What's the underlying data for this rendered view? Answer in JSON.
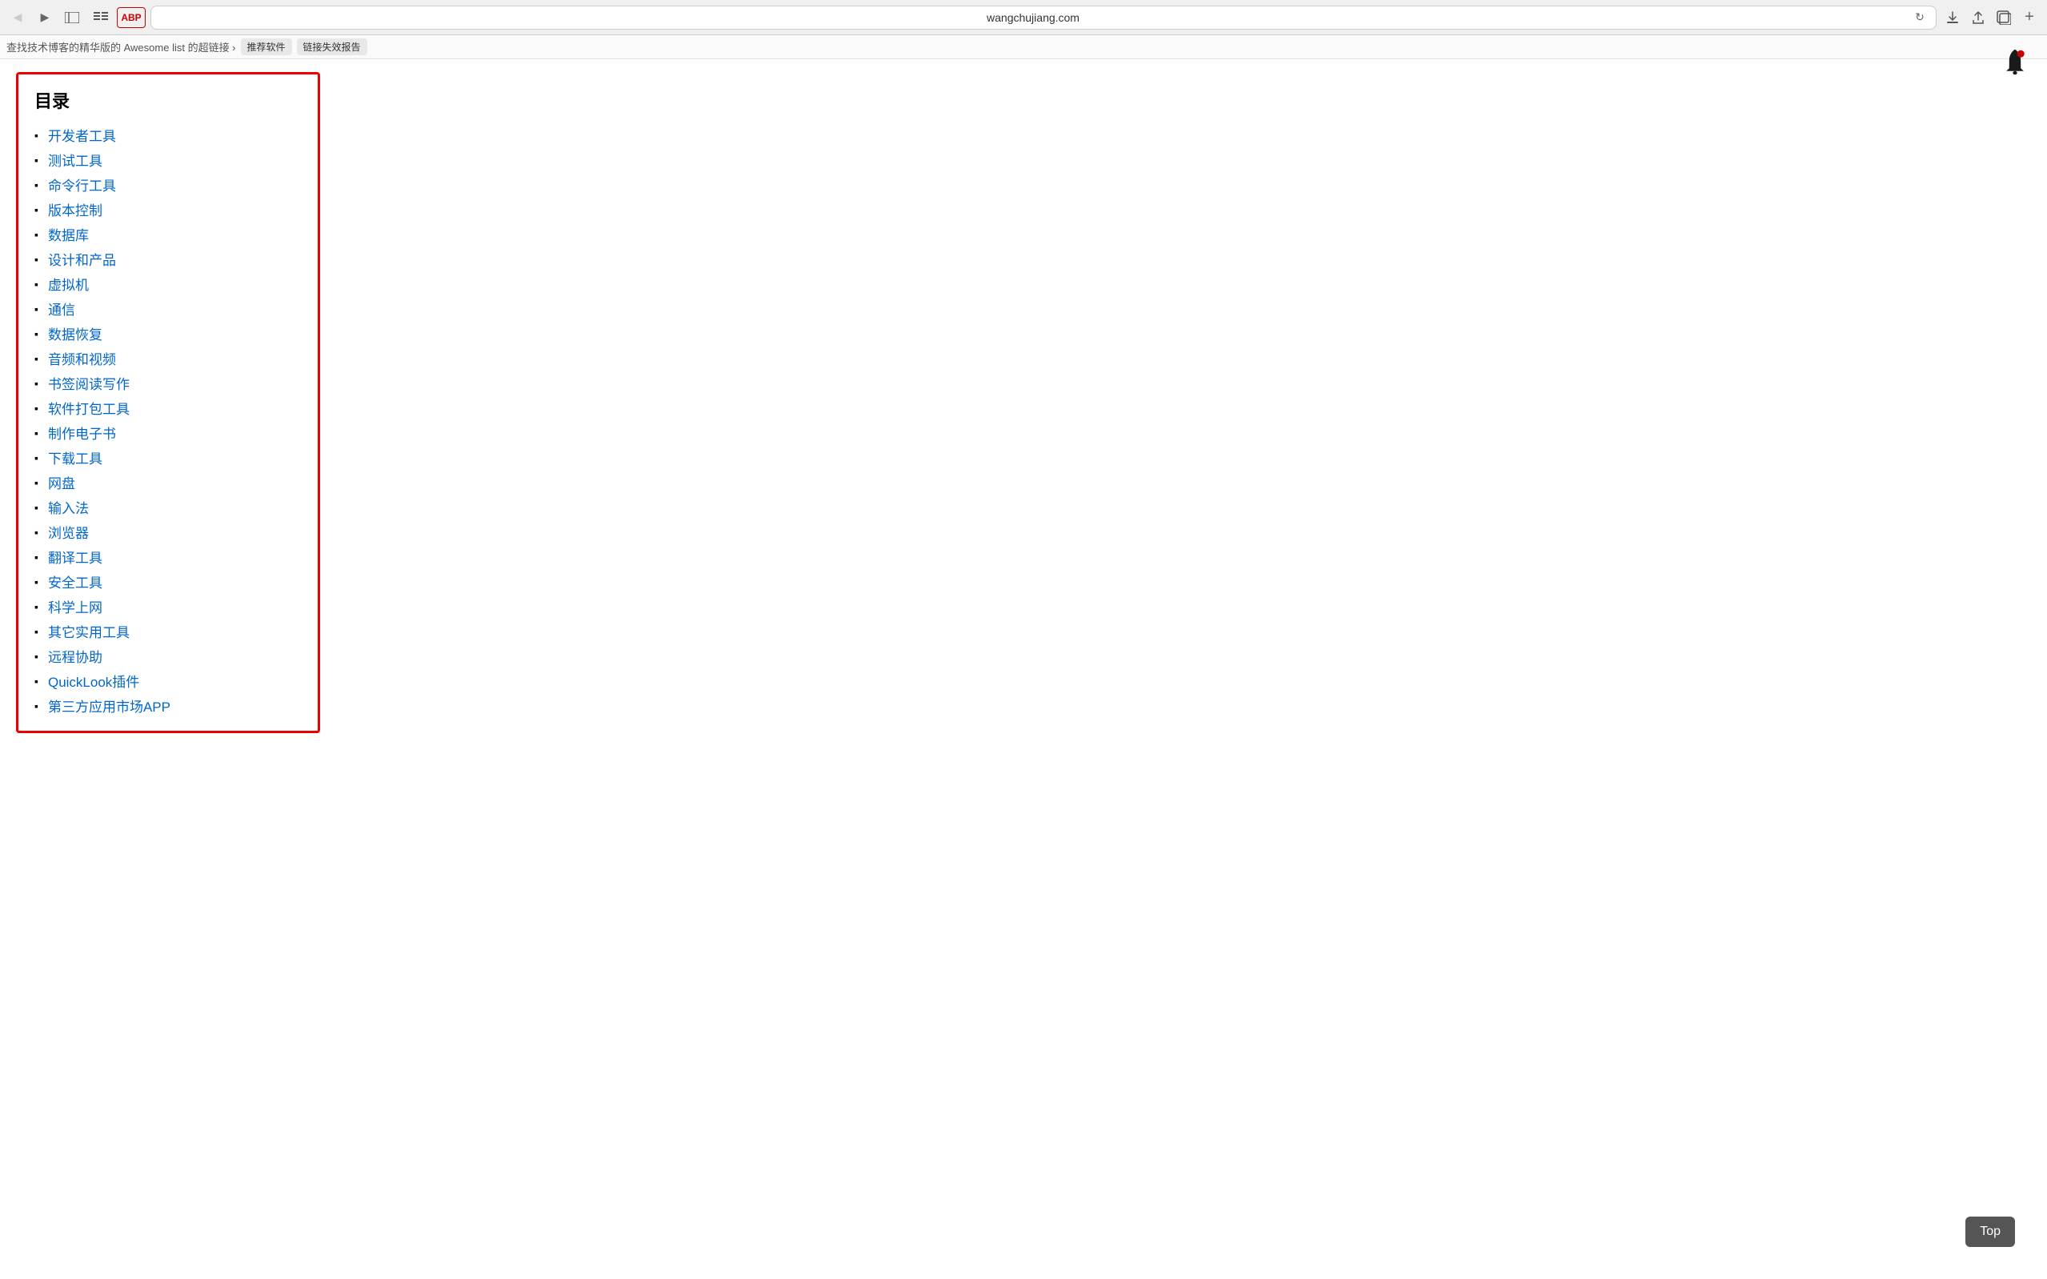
{
  "browser": {
    "url": "wangchujiang.com",
    "back_label": "◀",
    "forward_label": "▶",
    "sidebar_label": "⬜",
    "reload_label": "↻",
    "download_label": "⬇",
    "share_label": "⬆",
    "tabs_label": "⧉",
    "new_tab_label": "+",
    "abp_label": "ABP",
    "reader_label": "≡≡"
  },
  "breadcrumb": {
    "text": "查找技术博客的精华版的 Awesome list 的超链接 ›",
    "btn1": "推荐软件",
    "btn2": "链接失效报告"
  },
  "toc": {
    "title": "目录",
    "items": [
      "开发者工具",
      "测试工具",
      "命令行工具",
      "版本控制",
      "数据库",
      "设计和产品",
      "虚拟机",
      "通信",
      "数据恢复",
      "音频和视频",
      "书签阅读写作",
      "软件打包工具",
      "制作电子书",
      "下载工具",
      "网盘",
      "输入法",
      "浏览器",
      "翻译工具",
      "安全工具",
      "科学上网",
      "其它实用工具",
      "远程协助",
      "QuickLook插件",
      "第三方应用市场APP"
    ]
  },
  "top_btn": "Top"
}
